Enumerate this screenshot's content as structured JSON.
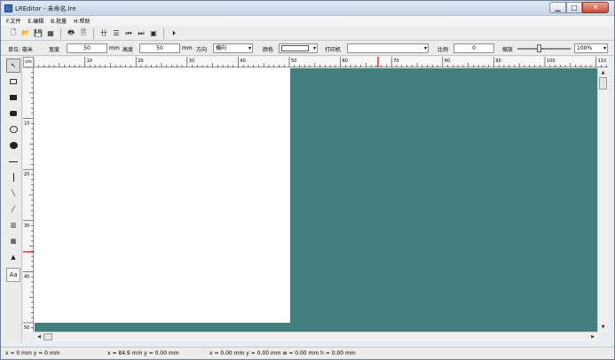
{
  "window": {
    "title": "LREditor - 未命名.lre"
  },
  "menu": [
    "F.文件",
    "E.编辑",
    "B.批量",
    "H.帮助"
  ],
  "toolbar_icons": [
    "new-file-icon",
    "open-folder-icon",
    "save-icon",
    "save-all-icon",
    "print-icon",
    "print-preview-icon",
    "align-columns-icon",
    "align-rows-icon",
    "first-page-icon",
    "last-page-icon",
    "run-icon",
    "exit-icon"
  ],
  "props": {
    "unit_label": "单位: 毫米",
    "width_label": "宽度",
    "width_value": "50",
    "width_unit": "mm",
    "height_label": "高度",
    "height_value": "50",
    "height_unit": "mm",
    "direction_label": "方向",
    "direction_value": "横向",
    "color_label": "颜色",
    "printer_label": "打印机",
    "printer_value": "",
    "ratio_label": "比例",
    "ratio_value": "0",
    "zoom_label": "缩放",
    "zoom_value": "100%",
    "zoom_slider_fraction": 0.4
  },
  "ruler": {
    "corner_label": "cm",
    "h_labels": [
      "10",
      "20",
      "30",
      "40",
      "50",
      "60",
      "70",
      "80",
      "90",
      "100",
      "110"
    ],
    "v_labels": [
      "10",
      "20",
      "30",
      "40",
      "50"
    ]
  },
  "tools": [
    "pointer-icon",
    "rectangle-outline-icon",
    "rectangle-filled-icon",
    "rounded-rect-icon",
    "ellipse-outline-icon",
    "ellipse-filled-icon",
    "horizontal-line-icon",
    "vertical-line-icon",
    "diagonal-down-line-icon",
    "diagonal-up-line-icon",
    "barcode-icon",
    "qrcode-icon",
    "image-icon",
    "text-icon"
  ],
  "text_tool_label": "Aa",
  "status": {
    "mouse": "x = 0 mm   y = 0 mm",
    "position": "x = 84.9 mm   y = 0.00 mm",
    "selection": "x = 0.00 mm   y = 0.00 mm   w = 0.00 mm   h = 0.00 mm"
  }
}
